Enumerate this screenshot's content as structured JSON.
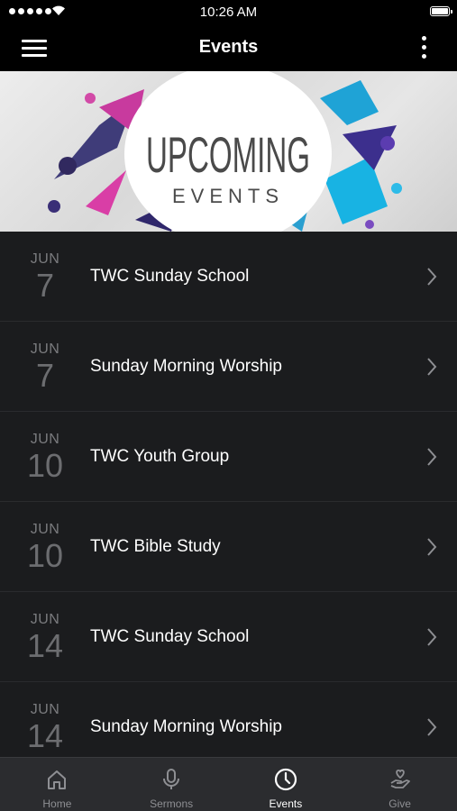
{
  "status_bar": {
    "time": "10:26 AM"
  },
  "nav": {
    "title": "Events"
  },
  "banner": {
    "line1": "UPCOMING",
    "line2": "EVENTS"
  },
  "events": [
    {
      "month": "JUN",
      "day": "7",
      "name": "TWC Sunday School"
    },
    {
      "month": "JUN",
      "day": "7",
      "name": "Sunday Morning Worship"
    },
    {
      "month": "JUN",
      "day": "10",
      "name": "TWC Youth Group"
    },
    {
      "month": "JUN",
      "day": "10",
      "name": "TWC Bible Study"
    },
    {
      "month": "JUN",
      "day": "14",
      "name": "TWC Sunday School"
    },
    {
      "month": "JUN",
      "day": "14",
      "name": "Sunday Morning Worship"
    }
  ],
  "tabs": [
    {
      "label": "Home",
      "icon": "home-icon"
    },
    {
      "label": "Sermons",
      "icon": "microphone-icon"
    },
    {
      "label": "Events",
      "icon": "clock-icon",
      "active": true
    },
    {
      "label": "Give",
      "icon": "give-hand-heart-icon"
    }
  ],
  "colors": {
    "background": "#1b1c1e",
    "bar": "#000000",
    "tab_bar": "#2b2c2f",
    "inactive": "#8e8f93"
  }
}
